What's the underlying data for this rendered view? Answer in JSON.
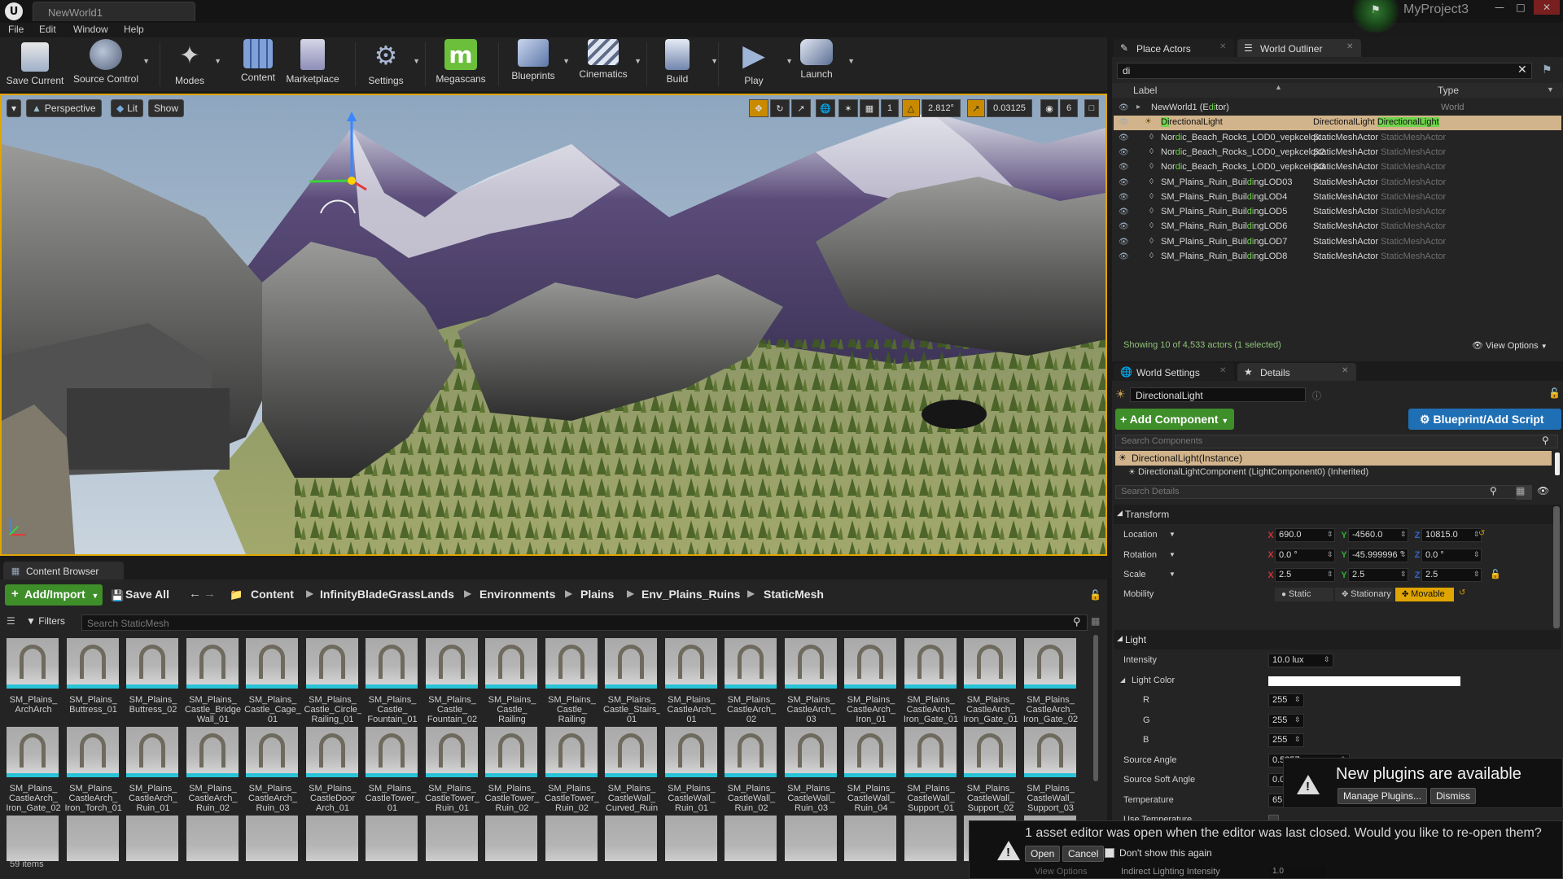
{
  "window": {
    "tab_title": "NewWorld1",
    "project_name": "MyProject3",
    "minimize": "—",
    "maximize": "□",
    "close": "✕"
  },
  "menu": [
    "File",
    "Edit",
    "Window",
    "Help"
  ],
  "toolbar": [
    {
      "label": "Save Current",
      "icon": "save-icon"
    },
    {
      "label": "Source Control",
      "icon": "source-control-icon"
    },
    {
      "label": "Modes",
      "icon": "modes-icon"
    },
    {
      "label": "Content",
      "icon": "content-icon"
    },
    {
      "label": "Marketplace",
      "icon": "marketplace-icon"
    },
    {
      "label": "Settings",
      "icon": "settings-icon"
    },
    {
      "label": "Megascans",
      "icon": "megascans-icon"
    },
    {
      "label": "Blueprints",
      "icon": "blueprints-icon"
    },
    {
      "label": "Cinematics",
      "icon": "cinematics-icon"
    },
    {
      "label": "Build",
      "icon": "build-icon"
    },
    {
      "label": "Play",
      "icon": "play-icon"
    },
    {
      "label": "Launch",
      "icon": "launch-icon"
    }
  ],
  "megascans_letter": "m",
  "viewport": {
    "dropdown_glyph": "▾",
    "perspective_label": "Perspective",
    "lit_label": "Lit",
    "show_label": "Show",
    "grid_snap_value": "1",
    "rotation_snap_value": "2.812°",
    "scale_snap_value": "0.03125",
    "camera_speed_value": "6"
  },
  "content_browser": {
    "tab_label": "Content Browser",
    "add_import_label": "Add/Import",
    "save_all_label": "Save All",
    "breadcrumbs": [
      "Content",
      "InfinityBladeGrassLands",
      "Environments",
      "Plains",
      "Env_Plains_Ruins",
      "StaticMesh"
    ],
    "filters_label": "Filters",
    "search_placeholder": "Search StaticMesh",
    "items_count": "59 items",
    "assets": [
      "SM_Plains_\nArchArch",
      "SM_Plains_\nButtress_01",
      "SM_Plains_\nButtress_02",
      "SM_Plains_\nCastle_Bridge\nWall_01",
      "SM_Plains_\nCastle_Cage_\n01",
      "SM_Plains_\nCastle_Circle_\nRailing_01",
      "SM_Plains_\nCastle_\nFountain_01",
      "SM_Plains_\nCastle_\nFountain_02",
      "SM_Plains_\nCastle_\nRailing",
      "SM_Plains_\nCastle_\nRailing",
      "SM_Plains_\nCastle_Stairs_\n01",
      "SM_Plains_\nCastleArch_\n01",
      "SM_Plains_\nCastleArch_\n02",
      "SM_Plains_\nCastleArch_\n03",
      "SM_Plains_\nCastleArch_\nIron_01",
      "SM_Plains_\nCastleArch_\nIron_Gate_01",
      "SM_Plains_\nCastleArch_\nIron_Gate_01",
      "SM_Plains_\nCastleArch_\nIron_Gate_02",
      "SM_Plains_\nCastleArch_\nIron_Gate_02",
      "SM_Plains_\nCastleArch_\nIron_Torch_01",
      "SM_Plains_\nCastleArch_\nRuin_01",
      "SM_Plains_\nCastleArch_\nRuin_02",
      "SM_Plains_\nCastleArch_\nRuin_03",
      "SM_Plains_\nCastleDoor\nArch_01",
      "SM_Plains_\nCastleTower_\n01",
      "SM_Plains_\nCastleTower_\nRuin_01",
      "SM_Plains_\nCastleTower_\nRuin_02",
      "SM_Plains_\nCastleTower_\nRuin_02",
      "SM_Plains_\nCastleWall_\nCurved_Ruin",
      "SM_Plains_\nCastleWall_\nRuin_01",
      "SM_Plains_\nCastleWall_\nRuin_02",
      "SM_Plains_\nCastleWall_\nRuin_03",
      "SM_Plains_\nCastleWall_\nRuin_04",
      "SM_Plains_\nCastleWall_\nSupport_01",
      "SM_Plains_\nCastleWall_\nSupport_02",
      "SM_Plains_\nCastleWall_\nSupport_03"
    ]
  },
  "outliner": {
    "place_actors_tab": "Place Actors",
    "world_outliner_tab": "World Outliner",
    "search_value": "di",
    "clear_glyph": "✕",
    "col_label": "Label",
    "col_type": "Type",
    "rows": [
      {
        "pre": "NewWorld1 (E",
        "hi": "di",
        "post": "tor)",
        "type": "World",
        "type_dim": ""
      },
      {
        "pre": "",
        "hi": "Di",
        "post": "rectionalLight",
        "type": "DirectionalLight",
        "type_dim": "DirectionalLight"
      },
      {
        "pre": "Nor",
        "hi": "di",
        "post": "c_Beach_Rocks_LOD0_vepkcelqx",
        "type": "StaticMeshActor",
        "type_dim": "StaticMeshActor"
      },
      {
        "pre": "Nor",
        "hi": "di",
        "post": "c_Beach_Rocks_LOD0_vepkcelqx2",
        "type": "StaticMeshActor",
        "type_dim": "StaticMeshActor"
      },
      {
        "pre": "Nor",
        "hi": "di",
        "post": "c_Beach_Rocks_LOD0_vepkcelqx3",
        "type": "StaticMeshActor",
        "type_dim": "StaticMeshActor"
      },
      {
        "pre": "SM_Plains_Ruin_Buil",
        "hi": "di",
        "post": "ngLOD03",
        "type": "StaticMeshActor",
        "type_dim": "StaticMeshActor"
      },
      {
        "pre": "SM_Plains_Ruin_Buil",
        "hi": "di",
        "post": "ngLOD4",
        "type": "StaticMeshActor",
        "type_dim": "StaticMeshActor"
      },
      {
        "pre": "SM_Plains_Ruin_Buil",
        "hi": "di",
        "post": "ngLOD5",
        "type": "StaticMeshActor",
        "type_dim": "StaticMeshActor"
      },
      {
        "pre": "SM_Plains_Ruin_Buil",
        "hi": "di",
        "post": "ngLOD6",
        "type": "StaticMeshActor",
        "type_dim": "StaticMeshActor"
      },
      {
        "pre": "SM_Plains_Ruin_Buil",
        "hi": "di",
        "post": "ngLOD7",
        "type": "StaticMeshActor",
        "type_dim": "StaticMeshActor"
      },
      {
        "pre": "SM_Plains_Ruin_Buil",
        "hi": "di",
        "post": "ngLOD8",
        "type": "StaticMeshActor",
        "type_dim": "StaticMeshActor"
      }
    ],
    "status": "Showing 10 of 4,533 actors (1 selected)",
    "view_options": "View Options"
  },
  "details": {
    "world_settings_tab": "World Settings",
    "details_tab": "Details",
    "actor_name": "DirectionalLight",
    "add_component_label": "Add Component",
    "blueprint_label": "Blueprint/Add Script",
    "search_components_placeholder": "Search Components",
    "component_root": "DirectionalLight(Instance)",
    "component_child": "DirectionalLightComponent (LightComponent0) (Inherited)",
    "search_details_placeholder": "Search Details",
    "transform_header": "Transform",
    "location_label": "Location",
    "location": [
      "690.0",
      "-4560.0",
      "10815.0"
    ],
    "rotation_label": "Rotation",
    "rotation": [
      "0.0 °",
      "-45.999996 °",
      "0.0 °"
    ],
    "scale_label": "Scale",
    "scale": [
      "2.5",
      "2.5",
      "2.5"
    ],
    "mobility_label": "Mobility",
    "mobility_options": [
      "Static",
      "Stationary",
      "Movable"
    ],
    "mobility_selected": "Movable",
    "light_header": "Light",
    "intensity_label": "Intensity",
    "intensity_value": "10.0 lux",
    "light_color_label": "Light Color",
    "r_label": "R",
    "r_value": "255",
    "g_label": "G",
    "g_value": "255",
    "b_label": "B",
    "b_value": "255",
    "source_angle_label": "Source Angle",
    "source_angle_value": "0.5357",
    "source_soft_angle_label": "Source Soft Angle",
    "source_soft_angle_value": "0.0",
    "temperature_label": "Temperature",
    "temperature_value": "65",
    "use_temperature_label": "Use Temperature",
    "indirect_label": "Indirect Lighting Intensity",
    "indirect_value": "1.0"
  },
  "notifications": {
    "plugins_title": "New plugins are available",
    "manage_plugins": "Manage Plugins...",
    "dismiss": "Dismiss",
    "asset_editor_msg": "1 asset editor was open when the editor was last closed. Would you like to re-open them?",
    "open": "Open",
    "cancel": "Cancel",
    "dont_show": "Don't show this again",
    "view_options_partial": "View Options",
    "warn_glyph": "!"
  },
  "colors": {
    "accent_green": "#3e8e29",
    "blueprint_blue": "#1f6fb5",
    "selection": "#d2b48c",
    "viewport_border": "#e0a500",
    "thumb_underline": "#28c3d8"
  }
}
